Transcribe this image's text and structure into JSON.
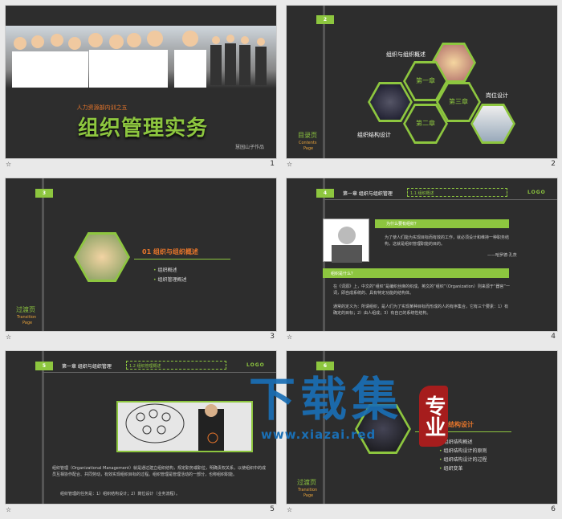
{
  "slides": [
    {
      "num": "1",
      "subtitle": "人力资源部内训之五",
      "title": "组织管理实务",
      "author": "慧园山子作品"
    },
    {
      "num": "2",
      "badge": "2",
      "contents": "目录页",
      "contents_en": "Contents",
      "contents_en2": "Page",
      "items": [
        "组织与组织概述",
        "岗位设计",
        "组织结构设计"
      ],
      "ch1": "第一章",
      "ch2": "第二章",
      "ch3": "第三章"
    },
    {
      "num": "3",
      "badge": "3",
      "heading": "01 组织与组织概述",
      "b1": "组织概述",
      "b2": "组织管理概述",
      "transition": "过渡页",
      "transition_en": "Transition",
      "transition_en2": "Page"
    },
    {
      "num": "4",
      "badge": "4",
      "chapter": "第一章 组织与组织管理",
      "section": "1.1 组织概述",
      "logo": "LOGO",
      "q1": "为什么要有组织？",
      "p1": "为了使人们能为实现目标而有效的工作，就必须设计和维持一种职务结构，这就是组织管理职能的目的。",
      "sig": "——哈罗德·孔茨",
      "q2": "组织是什么？",
      "p2": "在《词源》上，中文的“组织”是编织丝麻的织成。英文的“组织”（Organization）则来源于“器官”一词，即自成系统的、具有特定功能的结构体。",
      "p3": "通常的定义为：所谓组织，是人们为了实现某种目标而形成的人的有序集合，它有三个要素：1）有确定的目标；2）由人组成；3）有自己的系统性结构。"
    },
    {
      "num": "5",
      "badge": "5",
      "chapter": "第一章 组织与组织管理",
      "section": "1.2 组织管理概述",
      "logo": "LOGO",
      "p1": "组织管理（Organizational Management）就是通过建立组织结构，规定职务或职位，明确责权关系，以使组织中的成员互相协作配合、共同劳动，有效实现组织目标的过程。组织管理是管理活动的一部分，也称组织职能。",
      "p2": "组织管理的任务是：1）组织结构设计；2）岗位设计（业务流程）。"
    },
    {
      "num": "6",
      "badge": "6",
      "heading": "织结构设计",
      "bullets": [
        "组织结构概述",
        "组织结构设计的原则",
        "组织结构设计的过程",
        "组织变革"
      ],
      "transition": "过渡页",
      "transition_en": "Transition",
      "transition_en2": "Page",
      "wm_title": "下载集",
      "wm_tag": "专业",
      "wm_url": "www.xiazai.red"
    }
  ],
  "footer_star": "☆"
}
